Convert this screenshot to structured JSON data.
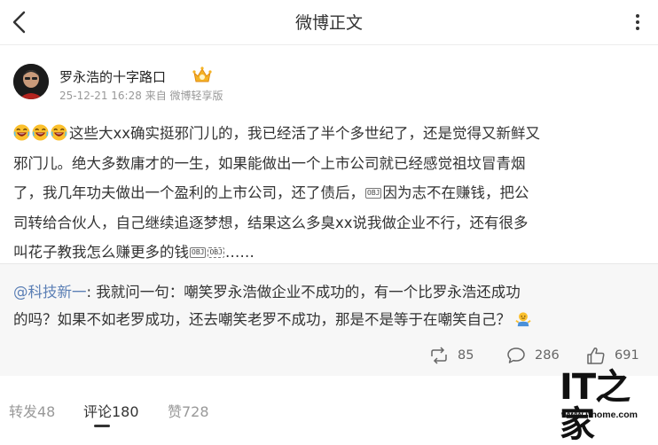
{
  "nav": {
    "title": "微博正文"
  },
  "author": {
    "name": "罗永浩的十字路口",
    "timestamp": "25-12-21 16:28",
    "source": "来自 微博轻享版"
  },
  "post": {
    "lines": [
      "这些大xx确实挺邪门儿的，我已经活了半个多世纪了，还是觉得又新鲜又",
      "邪门儿。绝大多数庸才的一生，如果能做出一个上市公司就已经感觉祖坟冒青烟",
      "了，我几年功夫做出一个盈利的上市公司，还了债后，",
      "因为志不在赚钱，把公",
      "司转给合伙人，自己继续追逐梦想，结果这么多臭xx说我做企业不行，还有很多",
      "叫花子教我怎么赚更多的钱",
      "……"
    ],
    "inline_tag": "OBJ",
    "inline_tags_end": [
      "OBJ",
      "OBJ"
    ]
  },
  "repost": {
    "mention": "@科技新一",
    "lines": [
      ": 我就问一句：嘲笑罗永浩做企业不成功的，有一个比罗永浩还成功",
      "的吗？如果不如老罗成功，还去嘲笑老罗不成功，那是不是等于在嘲笑自己？"
    ],
    "stats": {
      "reposts": "85",
      "comments": "286",
      "likes": "691"
    }
  },
  "tabs": [
    {
      "label": "转发48"
    },
    {
      "label": "评论180"
    },
    {
      "label": "赞728"
    }
  ],
  "watermark": {
    "logo": "IT之家",
    "url": "www.ithome.com"
  },
  "colors": {
    "mention": "#5b7fb5",
    "repost_bg": "#f7f7f7",
    "text": "#333333",
    "muted": "#999999"
  },
  "icons": [
    "back-arrow-icon",
    "more-dots-icon",
    "vip-crown-icon",
    "laughing-emoji-icon",
    "shrug-emoji-icon",
    "repost-icon",
    "comment-icon",
    "like-icon"
  ]
}
